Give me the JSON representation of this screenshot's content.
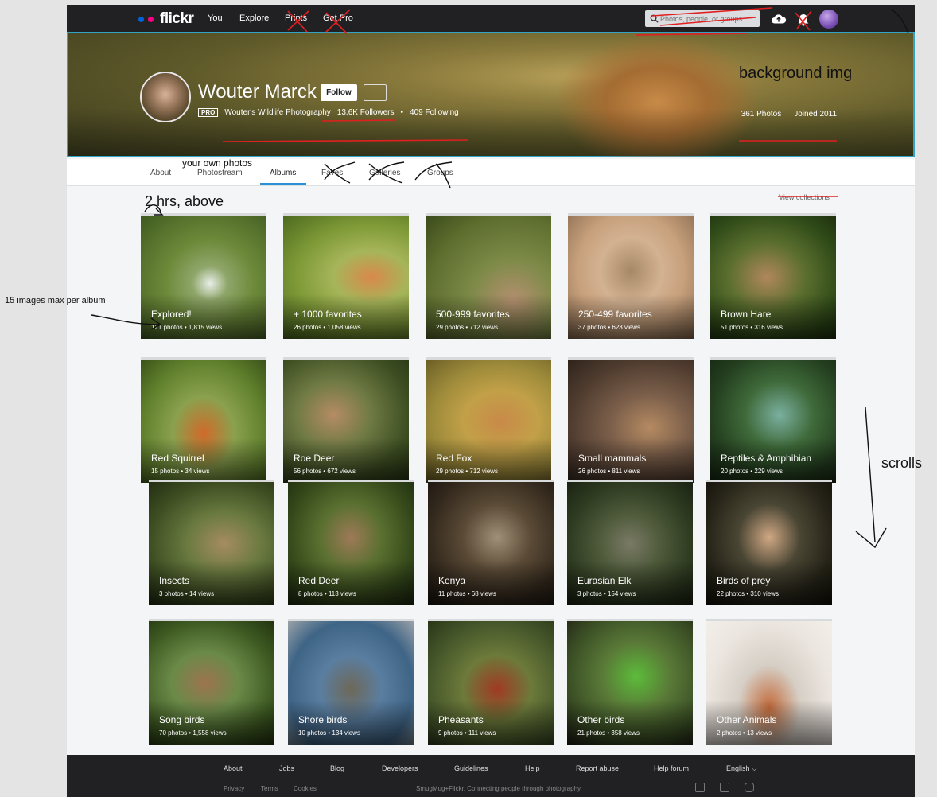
{
  "nav": {
    "logo_text": "flickr",
    "links": [
      "You",
      "Explore",
      "Prints",
      "Get Pro"
    ],
    "search_placeholder": "Photos, people, or groups"
  },
  "profile": {
    "name": "Wouter Marck",
    "follow_label": "Follow",
    "pro_label": "PRO",
    "tagline": "Wouter's Wildlife Photography",
    "followers": "13.6K Followers",
    "following": "409 Following",
    "photos": "361 Photos",
    "joined": "Joined 2011"
  },
  "tabs": [
    "About",
    "Photostream",
    "Albums",
    "Faves",
    "Galleries",
    "Groups"
  ],
  "active_tab": "Albums",
  "view_collections": "View collections",
  "albums": [
    {
      "title": "Explored!",
      "meta": "121 photos  •  1,815 views"
    },
    {
      "title": "+ 1000 favorites",
      "meta": "26 photos  •  1,058 views"
    },
    {
      "title": "500-999 favorites",
      "meta": "29 photos  •  712 views"
    },
    {
      "title": "250-499 favorites",
      "meta": "37 photos  •  623 views"
    },
    {
      "title": "Brown Hare",
      "meta": "51 photos  •  316 views"
    },
    {
      "title": "Red Squirrel",
      "meta": "15 photos  •  34 views"
    },
    {
      "title": "Roe Deer",
      "meta": "56 photos  •  672 views"
    },
    {
      "title": "Red Fox",
      "meta": "29 photos  •  712 views"
    },
    {
      "title": "Small mammals",
      "meta": "26 photos  •  811 views"
    },
    {
      "title": "Reptiles & Amphibian",
      "meta": "20 photos  •  229 views"
    },
    {
      "title": "Insects",
      "meta": "3 photos  •  14 views"
    },
    {
      "title": "Red Deer",
      "meta": "8 photos  •  113 views"
    },
    {
      "title": "Kenya",
      "meta": "11 photos  •  68 views"
    },
    {
      "title": "Eurasian Elk",
      "meta": "3 photos  •  154 views"
    },
    {
      "title": "Birds of prey",
      "meta": "22 photos  •  310 views"
    },
    {
      "title": "Song birds",
      "meta": "70 photos  •  1,558 views"
    },
    {
      "title": "Shore birds",
      "meta": "10 photos  •  134 views"
    },
    {
      "title": "Pheasants",
      "meta": "9 photos  •  111 views"
    },
    {
      "title": "Other birds",
      "meta": "21 photos  •  358 views"
    },
    {
      "title": "Other Animals",
      "meta": "2 photos  •  13 views"
    }
  ],
  "footer": {
    "links": [
      "About",
      "Jobs",
      "Blog",
      "Developers",
      "Guidelines",
      "Help",
      "Report abuse",
      "Help forum",
      "English ⌵"
    ],
    "sub_links": [
      "Privacy",
      "Terms",
      "Cookies"
    ],
    "tagline": "SmugMug+Flickr. Connecting people through photography."
  },
  "annotations": {
    "background": "background img",
    "own_photos": "your own photos",
    "hrs": "2 hrs, above",
    "max": "15 images max per album",
    "scrolls": "scrolls"
  },
  "colors": {
    "nav_bg": "#212124",
    "accent_blue": "#2c8fd6",
    "cover_border": "#32a3c4",
    "flickr_blue": "#0063dc",
    "flickr_pink": "#ff0084",
    "strike_red": "#e02020"
  }
}
